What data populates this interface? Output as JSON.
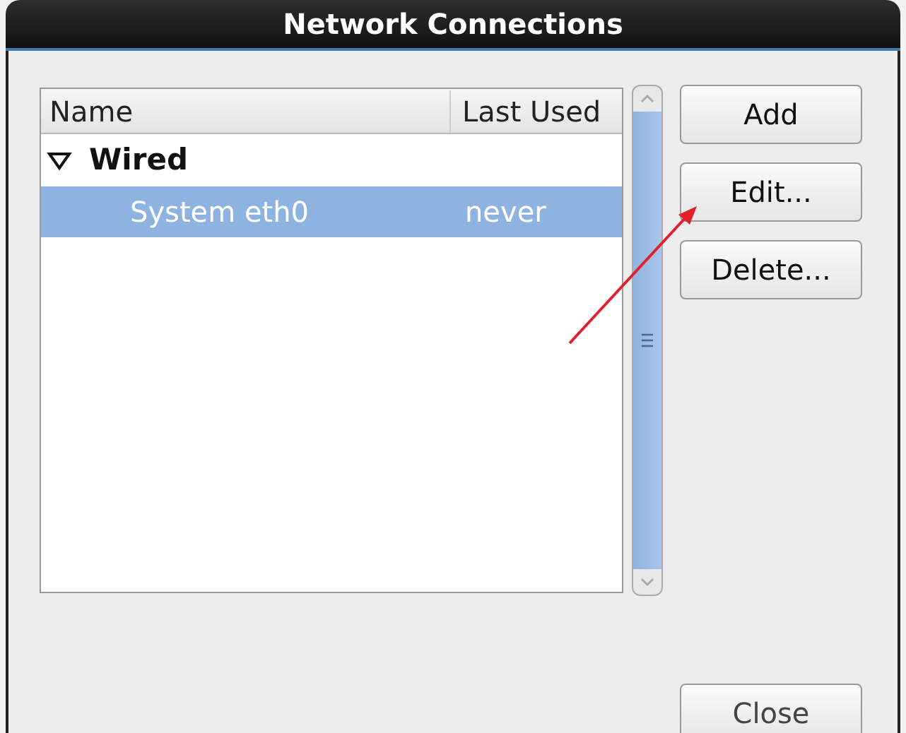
{
  "window": {
    "title": "Network Connections"
  },
  "table": {
    "columns": [
      "Name",
      "Last Used"
    ],
    "groups": [
      {
        "label": "Wired",
        "expanded": true,
        "children": [
          {
            "name": "System eth0",
            "last_used": "never",
            "selected": true
          }
        ]
      }
    ]
  },
  "buttons": [
    "Add",
    "Edit...",
    "Delete..."
  ],
  "close_button": "Close",
  "annotation": {
    "kind": "arrow"
  }
}
